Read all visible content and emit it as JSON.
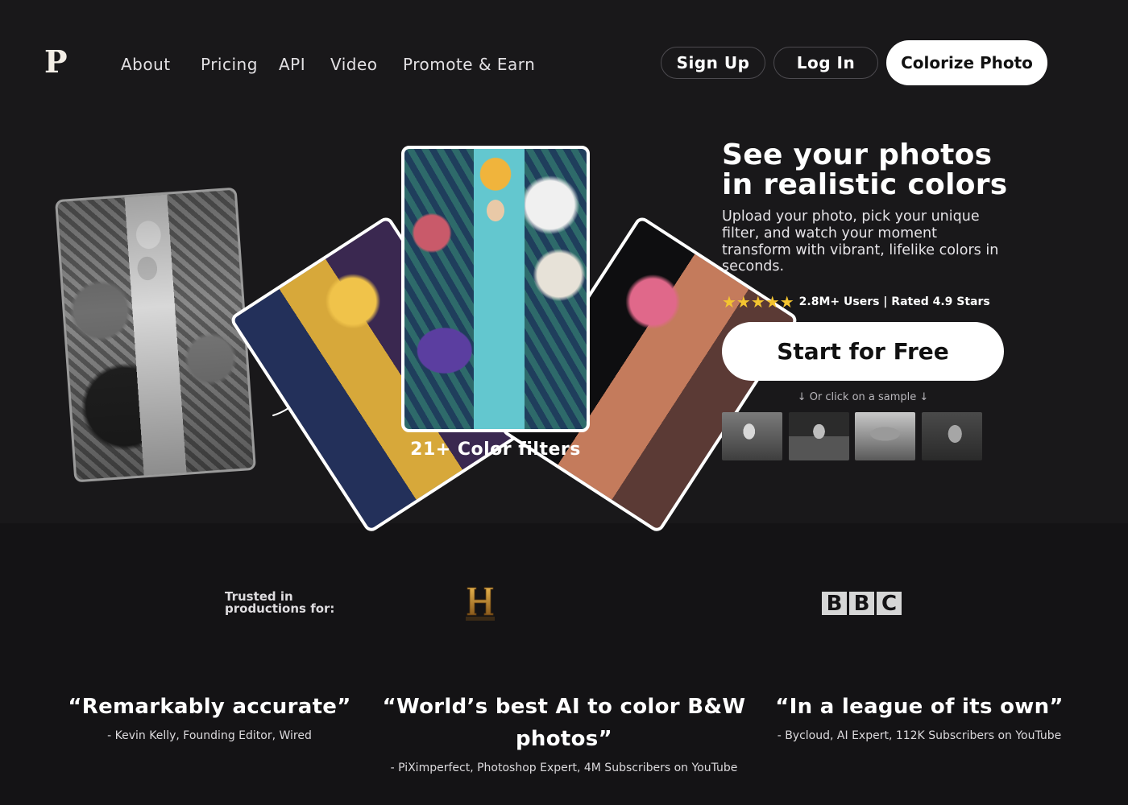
{
  "nav": {
    "logo": "P",
    "links": [
      "About",
      "Pricing",
      "API",
      "Video",
      "Promote & Earn"
    ],
    "sign_up": "Sign Up",
    "log_in": "Log In",
    "colorize": "Colorize Photo"
  },
  "hero": {
    "title_line1": "See your photos",
    "title_line2": "in realistic colors",
    "description": "Upload your photo, pick your unique filter, and watch your moment transform with vibrant, lifelike colors in seconds.",
    "stars": "★★★★★",
    "rating_text": "2.8M+ Users | Rated 4.9 Stars",
    "cta": "Start for Free",
    "sample_hint": "↓ Or click on a sample ↓",
    "filters_label": "21+ Color filters"
  },
  "trusted": {
    "label_line1": "Trusted in",
    "label_line2": "productions for:",
    "bbc_letters": [
      "B",
      "B",
      "C"
    ]
  },
  "quotes": [
    {
      "text": "“Remarkably accurate”",
      "author": "- Kevin Kelly, Founding Editor, Wired"
    },
    {
      "text": "“World’s best AI to color B&W photos”",
      "author": "- PiXimperfect, Photoshop Expert, 4M Subscribers on YouTube"
    },
    {
      "text": "“In a league of its own”",
      "author": "- Bycloud, AI Expert, 112K Subscribers on YouTube"
    }
  ],
  "colors": {
    "background": "#19181a",
    "star": "#f4c430",
    "button_bg": "#ffffff"
  }
}
